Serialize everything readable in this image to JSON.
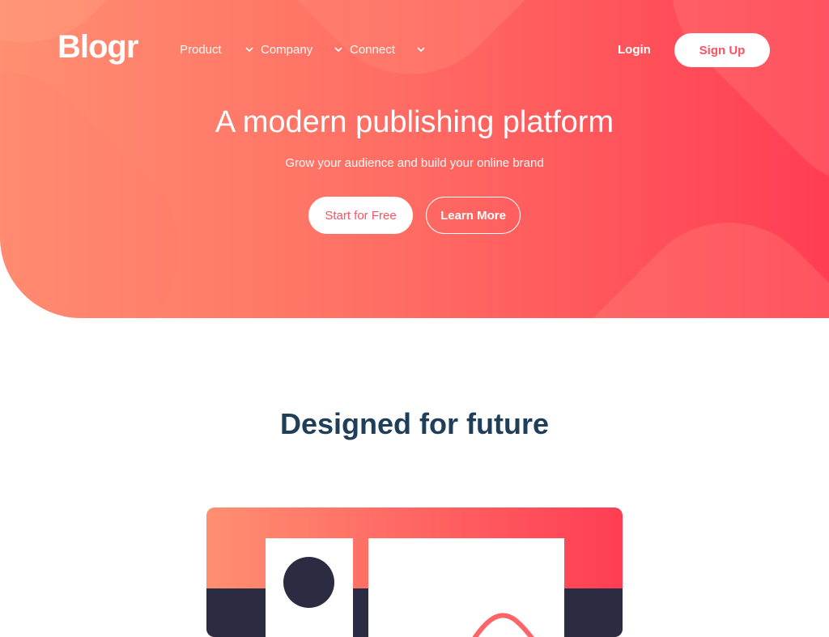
{
  "header": {
    "logo": "Blogr",
    "nav": [
      {
        "label": "Product"
      },
      {
        "label": "Company"
      },
      {
        "label": "Connect"
      }
    ],
    "login_label": "Login",
    "signup_label": "Sign Up"
  },
  "hero": {
    "title": "A modern publishing platform",
    "subtitle": "Grow your audience and build your online brand",
    "primary_cta": "Start for Free",
    "secondary_cta": "Learn More"
  },
  "section": {
    "title": "Designed for future"
  },
  "icons": {
    "chevron": "chevron-down-icon"
  },
  "colors": {
    "gradient_start": "#ff8f71",
    "gradient_end": "#ff3d54",
    "accent_text": "#ff515f",
    "heading_dark": "#1f3e5a",
    "illustration_dark": "#2b2c41"
  }
}
